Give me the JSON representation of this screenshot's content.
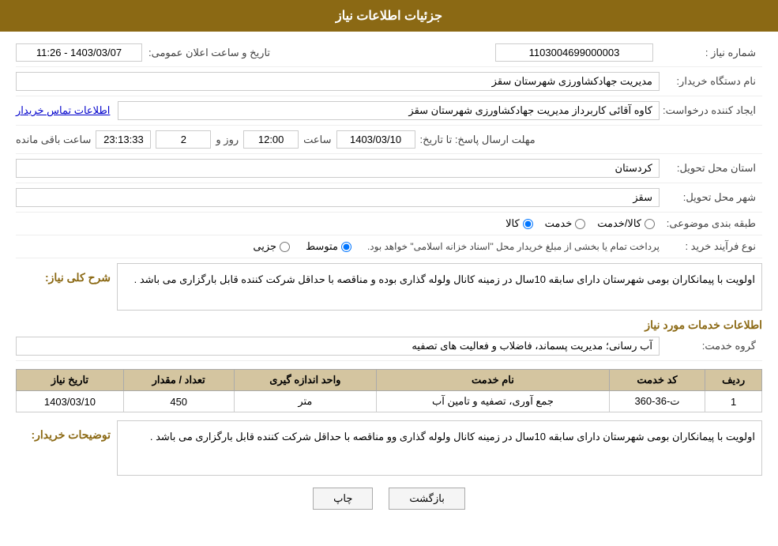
{
  "header": {
    "title": "جزئیات اطلاعات نیاز"
  },
  "fields": {
    "need_number_label": "شماره نیاز :",
    "need_number_value": "1103004699000003",
    "buyer_org_label": "نام دستگاه خریدار:",
    "buyer_org_value": "مدیریت جهادکشاورزی شهرستان سقز",
    "creator_label": "ایجاد کننده درخواست:",
    "creator_value": "کاوه آقائی کاربرداز مدیریت جهادکشاورزی شهرستان سقز",
    "contact_link": "اطلاعات تماس خریدار",
    "deadline_label": "مهلت ارسال پاسخ: تا تاریخ:",
    "deadline_date": "1403/03/10",
    "deadline_time_label": "ساعت",
    "deadline_time": "12:00",
    "deadline_day_label": "روز و",
    "deadline_days": "2",
    "deadline_remaining_label": "ساعت باقی مانده",
    "deadline_remaining": "23:13:33",
    "announce_label": "تاریخ و ساعت اعلان عمومی:",
    "announce_value": "1403/03/07 - 11:26",
    "province_label": "استان محل تحویل:",
    "province_value": "کردستان",
    "city_label": "شهر محل تحویل:",
    "city_value": "سقز",
    "category_label": "طبقه بندی موضوعی:",
    "category_options": [
      "کالا",
      "خدمت",
      "کالا/خدمت"
    ],
    "category_selected": "کالا",
    "purchase_label": "نوع فرآیند خرید :",
    "purchase_options": [
      "جزیی",
      "متوسط"
    ],
    "purchase_selected": "متوسط",
    "purchase_note": "پرداخت تمام یا بخشی از مبلغ خریدار محل \"اسناد خزانه اسلامی\" خواهد بود.",
    "need_desc_label": "شرح کلی نیاز:",
    "need_desc_value": "اولویت با پیمانکاران بومی شهرستان دارای سابقه 10سال در زمینه کانال ولوله گذاری بوده و مناقصه با حداقل شرکت کننده قابل بارگزاری می باشد .",
    "services_section_title": "اطلاعات خدمات مورد نیاز",
    "service_group_label": "گروه خدمت:",
    "service_group_value": "آب رسانی؛ مدیریت پسماند، فاضلاب و فعالیت های تصفیه",
    "table": {
      "headers": [
        "ردیف",
        "کد خدمت",
        "نام خدمت",
        "واحد اندازه گیری",
        "تعداد / مقدار",
        "تاریخ نیاز"
      ],
      "rows": [
        {
          "row": "1",
          "code": "ت-36-360",
          "name": "جمع آوری، تصفیه و تامین آب",
          "unit": "متر",
          "quantity": "450",
          "date": "1403/03/10"
        }
      ]
    },
    "buyer_notes_label": "توضیحات خریدار:",
    "buyer_notes_value": "اولویت با پیمانکاران بومی شهرستان دارای سابقه 10سال در زمینه کانال ولوله گذاری وو مناقصه با حداقل شرکت کننده قابل بارگزاری می باشد ."
  },
  "buttons": {
    "back_label": "بازگشت",
    "print_label": "چاپ"
  }
}
